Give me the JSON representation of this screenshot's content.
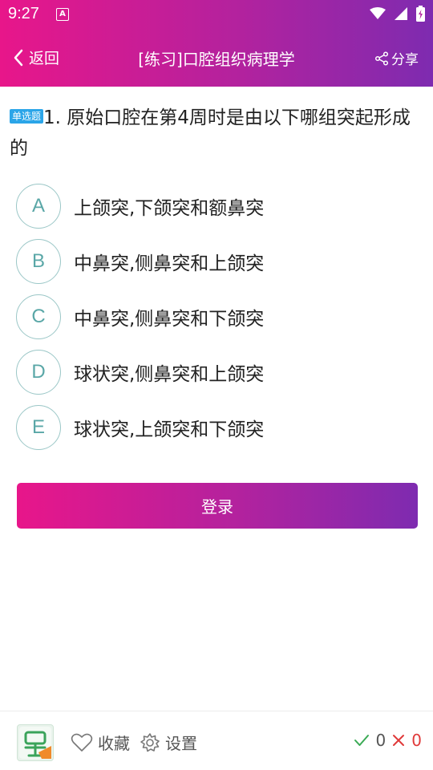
{
  "status": {
    "time": "9:27",
    "app_icon_letter": "A"
  },
  "nav": {
    "back_label": "返回",
    "title": "[练习]口腔组织病理学",
    "share_label": "分享"
  },
  "question": {
    "type_badge": "单选题",
    "text": "1. 原始口腔在第4周时是由以下哪组突起形成的"
  },
  "options": [
    {
      "letter": "A",
      "text": "上颌突,下颌突和额鼻突"
    },
    {
      "letter": "B",
      "text": "中鼻突,侧鼻突和上颌突"
    },
    {
      "letter": "C",
      "text": "中鼻突,侧鼻突和下颌突"
    },
    {
      "letter": "D",
      "text": "球状突,侧鼻突和上颌突"
    },
    {
      "letter": "E",
      "text": "球状突,上颌突和下颌突"
    }
  ],
  "login": {
    "label": "登录"
  },
  "bottom": {
    "favorite_label": "收藏",
    "settings_label": "设置",
    "correct_count": "0",
    "wrong_count": "0"
  },
  "colors": {
    "gradient_start": "#e8168a",
    "gradient_end": "#7e2bb0",
    "badge": "#2ba5e8",
    "option_accent": "#5aa7a7",
    "correct": "#3aaa55",
    "wrong": "#e03a3a"
  }
}
